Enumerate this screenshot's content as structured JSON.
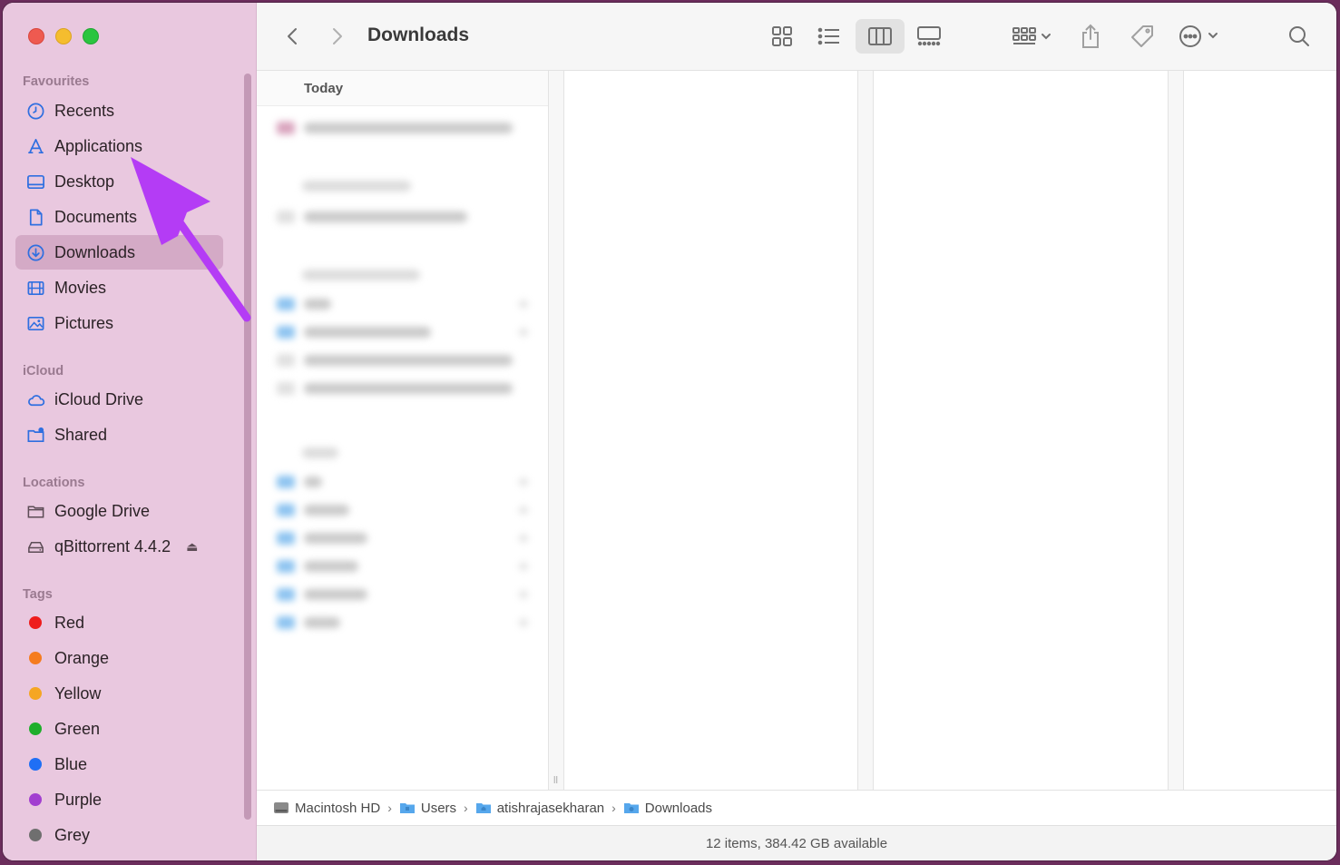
{
  "window": {
    "title": "Downloads"
  },
  "sidebar": {
    "sections": {
      "favourites": "Favourites",
      "icloud": "iCloud",
      "locations": "Locations",
      "tags": "Tags"
    },
    "favourites": [
      {
        "label": "Recents",
        "icon": "clock-icon"
      },
      {
        "label": "Applications",
        "icon": "applications-icon"
      },
      {
        "label": "Desktop",
        "icon": "desktop-icon"
      },
      {
        "label": "Documents",
        "icon": "document-icon"
      },
      {
        "label": "Downloads",
        "icon": "download-icon",
        "selected": true
      },
      {
        "label": "Movies",
        "icon": "film-icon"
      },
      {
        "label": "Pictures",
        "icon": "photo-icon"
      }
    ],
    "icloud": [
      {
        "label": "iCloud Drive",
        "icon": "cloud-icon"
      },
      {
        "label": "Shared",
        "icon": "shared-folder-icon"
      }
    ],
    "locations": [
      {
        "label": "Google Drive",
        "icon": "folder-icon"
      },
      {
        "label": "qBittorrent 4.4.2",
        "icon": "drive-icon",
        "eject": true
      }
    ],
    "tags": [
      {
        "label": "Red",
        "color": "#ee1c1c"
      },
      {
        "label": "Orange",
        "color": "#f57c1f"
      },
      {
        "label": "Yellow",
        "color": "#f5a623"
      },
      {
        "label": "Green",
        "color": "#1fae2b"
      },
      {
        "label": "Blue",
        "color": "#1f6ff5"
      },
      {
        "label": "Purple",
        "color": "#a23fd0"
      },
      {
        "label": "Grey",
        "color": "#6f6f6f"
      }
    ]
  },
  "content": {
    "column_header": "Today"
  },
  "pathbar": {
    "crumbs": [
      "Macintosh HD",
      "Users",
      "atishrajasekharan",
      "Downloads"
    ],
    "separator": "›"
  },
  "status": {
    "text": "12 items, 384.42 GB available"
  },
  "colors": {
    "sidebar_bg": "#e9c8df",
    "selected_bg": "#d4aac6",
    "accent": "#2f6fe0",
    "annotation_arrow": "#b43cf5"
  }
}
